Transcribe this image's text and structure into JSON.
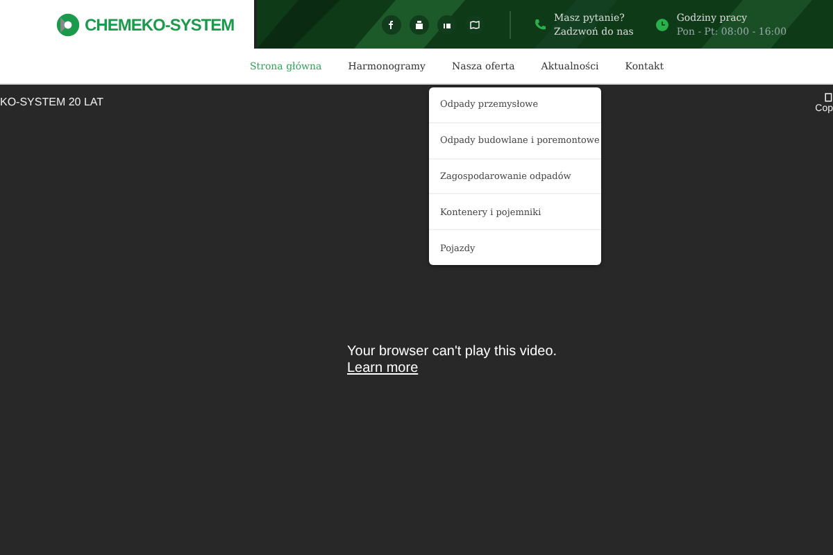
{
  "logo": {
    "text": "CHEMEKO-SYSTEM"
  },
  "contact": [
    {
      "kind": "phone",
      "label": "Masz pytanie?",
      "value": "Zadzwoń do nas"
    },
    {
      "kind": "clock",
      "label": "Godziny pracy",
      "value": "Pon - Pt: 08:00 - 16:00"
    }
  ],
  "nav": [
    {
      "label": "Strona główna",
      "selected": true
    },
    {
      "label": "Harmonogramy",
      "selected": false
    },
    {
      "label": "Nasza oferta",
      "selected": false
    },
    {
      "label": "Aktualności",
      "selected": false
    },
    {
      "label": "Kontakt",
      "selected": false
    }
  ],
  "dropdown": [
    "Odpady przemysłowe",
    "Odpady budowlane i poremontowe",
    "Zagospodarowanie odpadów",
    "Kontenery i pojemniki",
    "Pojazdy"
  ],
  "video": {
    "title": "KO-SYSTEM 20 LAT",
    "message": "Your browser can't play this video.",
    "link": "Learn more",
    "side_text": "Cop"
  }
}
